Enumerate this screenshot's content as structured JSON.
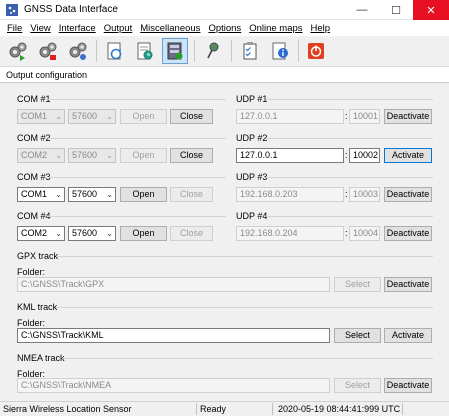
{
  "window": {
    "title": "GNSS Data Interface",
    "minimize": "—",
    "maximize": "☐",
    "close": "✕"
  },
  "menu": [
    "File",
    "View",
    "Interface",
    "Output",
    "Miscellaneous",
    "Options",
    "Online maps",
    "Help"
  ],
  "toolbar": {
    "buttons": [
      {
        "icon": "gears-connect-icon"
      },
      {
        "icon": "gears-disconnect-icon"
      },
      {
        "icon": "gears-settings-icon"
      },
      {
        "icon": "refresh-document-icon"
      },
      {
        "icon": "document-clock-icon"
      },
      {
        "icon": "output-config-icon",
        "active": true
      },
      {
        "icon": "pin-icon"
      },
      {
        "icon": "checklist-icon"
      },
      {
        "icon": "info-icon"
      },
      {
        "icon": "power-icon"
      }
    ]
  },
  "tab": {
    "label": "Output configuration"
  },
  "com_ports": [
    {
      "label": "COM #1",
      "port": "COM1",
      "baud": "57600",
      "open": "Open",
      "close": "Close",
      "enabled": false
    },
    {
      "label": "COM #2",
      "port": "COM2",
      "baud": "57600",
      "open": "Open",
      "close": "Close",
      "enabled": false
    },
    {
      "label": "COM #3",
      "port": "COM1",
      "baud": "57600",
      "open": "Open",
      "close": "Close",
      "enabled": true
    },
    {
      "label": "COM #4",
      "port": "COM2",
      "baud": "57600",
      "open": "Open",
      "close": "Close",
      "enabled": true
    }
  ],
  "udp": [
    {
      "label": "UDP #1",
      "ip": "127.0.0.1",
      "port": "10001",
      "action": "Deactivate",
      "enabled": false
    },
    {
      "label": "UDP #2",
      "ip": "127.0.0.1",
      "port": "10002",
      "action": "Activate",
      "enabled": true
    },
    {
      "label": "UDP #3",
      "ip": "192.168.0.203",
      "port": "10003",
      "action": "Deactivate",
      "enabled": false
    },
    {
      "label": "UDP #4",
      "ip": "192.168.0.204",
      "port": "10004",
      "action": "Deactivate",
      "enabled": false
    }
  ],
  "tracks": [
    {
      "title": "GPX track",
      "folder_label": "Folder:",
      "path": "C:\\GNSS\\Track\\GPX",
      "select": "Select",
      "action": "Deactivate",
      "enabled": false
    },
    {
      "title": "KML track",
      "folder_label": "Folder:",
      "path": "C:\\GNSS\\Track\\KML",
      "select": "Select",
      "action": "Activate",
      "enabled": true
    },
    {
      "title": "NMEA track",
      "folder_label": "Folder:",
      "path": "C:\\GNSS\\Track\\NMEA",
      "select": "Select",
      "action": "Deactivate",
      "enabled": false
    }
  ],
  "status": {
    "device": "Sierra Wireless Location Sensor",
    "state": "Ready",
    "timestamp": "2020-05-19 08:44:41:999 UTC"
  },
  "colors": {
    "accent": "#0078d7",
    "close_hover": "#e81123",
    "active_tool": "#cce4f7"
  }
}
